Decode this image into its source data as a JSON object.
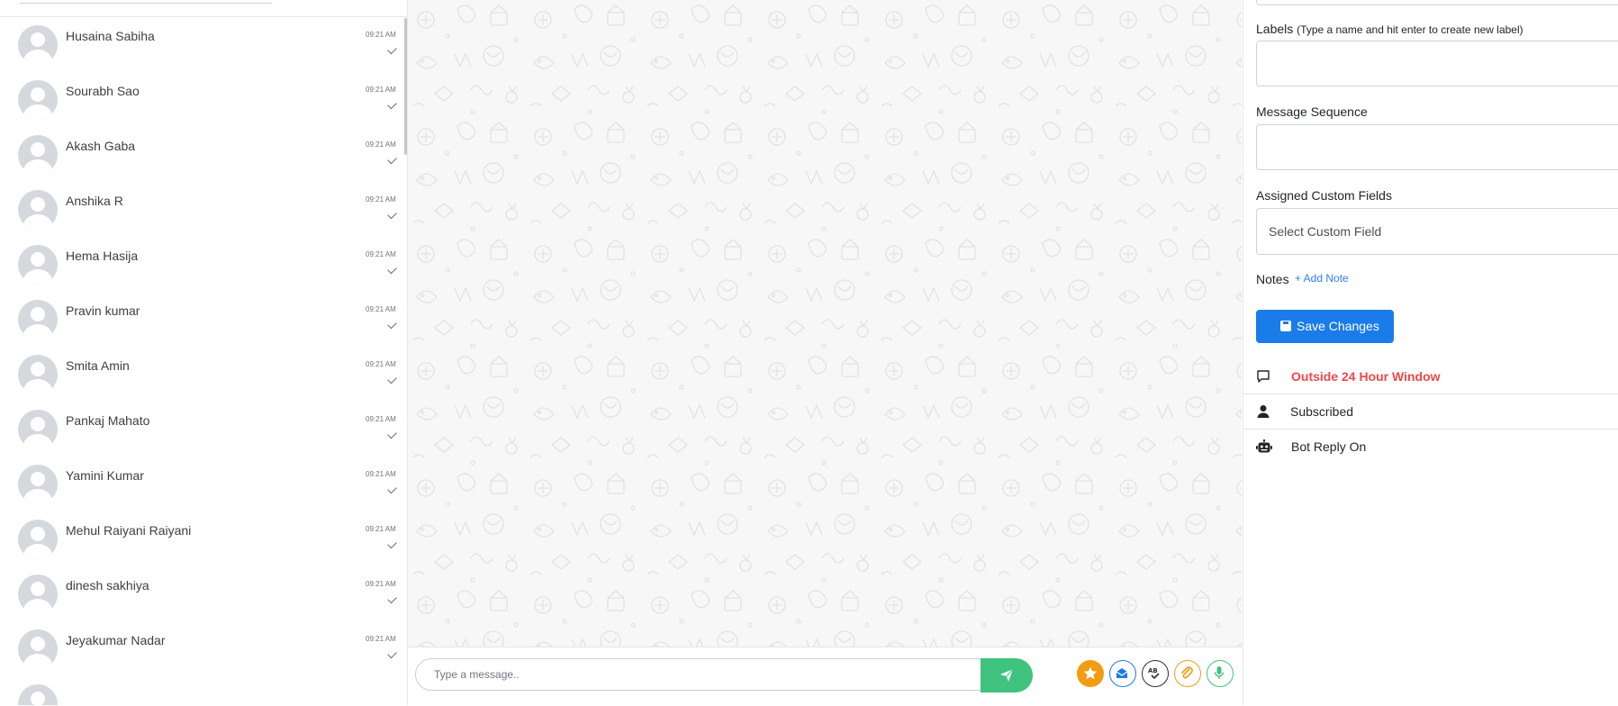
{
  "contacts": [
    {
      "name": "Husaina Sabiha",
      "time": "09:21 AM"
    },
    {
      "name": "Sourabh Sao",
      "time": "09:21 AM"
    },
    {
      "name": "Akash Gaba",
      "time": "09:21 AM"
    },
    {
      "name": "Anshika R",
      "time": "09:21 AM"
    },
    {
      "name": "Hema Hasija",
      "time": "09:21 AM"
    },
    {
      "name": "Pravin kumar",
      "time": "09:21 AM"
    },
    {
      "name": "Smita Amin",
      "time": "09:21 AM"
    },
    {
      "name": "Pankaj Mahato",
      "time": "09:21 AM"
    },
    {
      "name": "Yamini Kumar",
      "time": "09:21 AM"
    },
    {
      "name": "Mehul Raiyani Raiyani",
      "time": "09:21 AM"
    },
    {
      "name": "dinesh sakhiya",
      "time": "09:21 AM"
    },
    {
      "name": "Jeyakumar Nadar",
      "time": "09:21 AM"
    }
  ],
  "composer": {
    "placeholder": "Type a message.."
  },
  "panel": {
    "labels_title": "Labels",
    "labels_hint": "(Type a name and hit enter to create new label)",
    "sequence_title": "Message Sequence",
    "custom_fields_title": "Assigned Custom Fields",
    "custom_field_placeholder": "Select Custom Field",
    "notes_title": "Notes",
    "add_note": "+ Add Note",
    "save_button": "Save Changes",
    "window_status": "Outside 24 Hour Window",
    "subscription_status": "Subscribed",
    "bot_status": "Bot Reply On"
  },
  "colors": {
    "accent_blue": "#1a7ce8",
    "send_green": "#3fc37e",
    "warning_red": "#f0474d",
    "star_orange": "#f39c12"
  },
  "icons": [
    "check-icon",
    "send-icon",
    "star-icon",
    "email-icon",
    "spellcheck-icon",
    "paperclip-icon",
    "microphone-icon",
    "comment-icon",
    "user-icon",
    "robot-icon",
    "save-icon",
    "plus-icon"
  ]
}
